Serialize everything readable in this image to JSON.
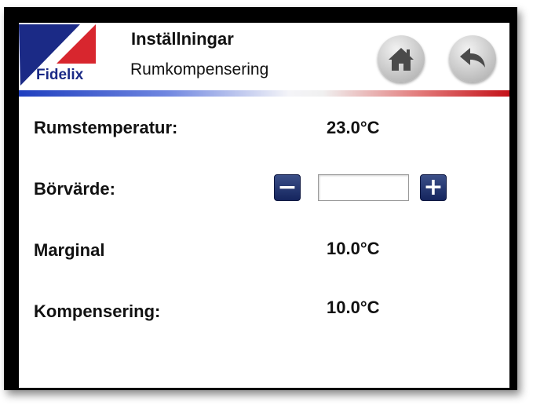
{
  "header": {
    "logo_text": "Fidelix",
    "title": "Inställningar",
    "subtitle": "Rumkompensering",
    "colors": {
      "brand_blue": "#1b2a86",
      "brand_red": "#d8262e"
    },
    "home_icon": "home-icon",
    "back_icon": "back-arrow-icon"
  },
  "rows": {
    "room_temp": {
      "label": "Rumstemperatur:",
      "value": "23.0°C"
    },
    "setpoint": {
      "label": "Börvärde:",
      "input_value": "",
      "minus_glyph": "−",
      "plus_glyph": "+"
    },
    "margin": {
      "label": "Marginal",
      "value": "10.0°C"
    },
    "compensation": {
      "label": "Kompensering:",
      "value": "10.0°C"
    }
  }
}
